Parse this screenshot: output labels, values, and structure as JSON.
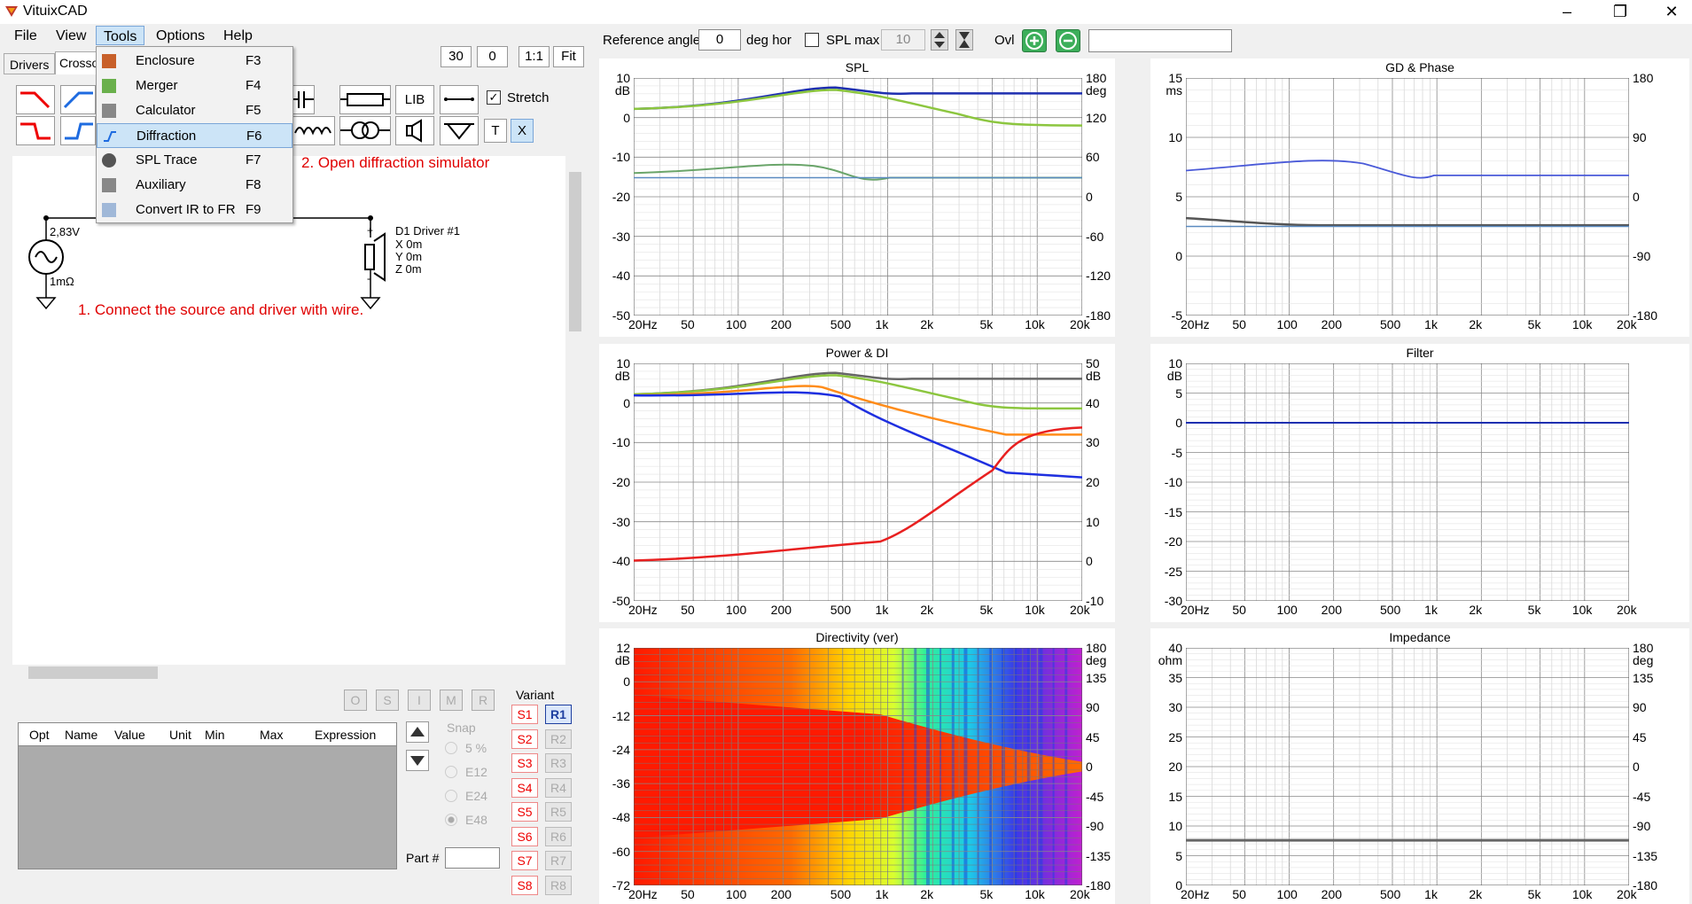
{
  "app": {
    "title": "VituixCAD"
  },
  "menu": {
    "file": "File",
    "view": "View",
    "tools": "Tools",
    "options": "Options",
    "help": "Help"
  },
  "tabs": {
    "drivers": "Drivers",
    "crossover": "Crosso"
  },
  "dropdown": [
    {
      "label": "Enclosure",
      "key": "F3",
      "icon": "enclosure-icon"
    },
    {
      "label": "Merger",
      "key": "F4",
      "icon": "merger-icon"
    },
    {
      "label": "Calculator",
      "key": "F5",
      "icon": "calculator-icon"
    },
    {
      "label": "Diffraction",
      "key": "F6",
      "icon": "diffraction-icon"
    },
    {
      "label": "SPL Trace",
      "key": "F7",
      "icon": "spl-trace-icon"
    },
    {
      "label": "Auxiliary",
      "key": "F8",
      "icon": "auxiliary-icon"
    },
    {
      "label": "Convert IR to FR",
      "key": "F9",
      "icon": "convert-icon"
    }
  ],
  "toolbar": {
    "zoom30": "30",
    "zoom0": "0",
    "oneToOne": "1:1",
    "fit": "Fit",
    "lib": "LIB",
    "stretch": "Stretch",
    "t": "T",
    "x": "X"
  },
  "top": {
    "refAngleLabel": "Reference angle",
    "refAngleValue": "0",
    "degHor": "deg hor",
    "splMax": "SPL max",
    "splMaxValue": "10",
    "ovl": "Ovl"
  },
  "annotations": {
    "a1": "1. Connect the source and driver with wire.",
    "a2": "2. Open diffraction simulator"
  },
  "schematic": {
    "voltage": "2,83V",
    "resistance": "1mΩ",
    "driverName": "D1 Driver #1",
    "x": "X 0m",
    "y": "Y 0m",
    "z": "Z 0m"
  },
  "table": {
    "headers": [
      "Opt",
      "Name",
      "Value",
      "Unit",
      "Min",
      "Max",
      "Expression"
    ]
  },
  "params": {
    "o": "O",
    "s": "S",
    "i": "I",
    "m": "M",
    "r": "R"
  },
  "snap": {
    "title": "Snap",
    "options": [
      "5 %",
      "E12",
      "E24",
      "E48"
    ]
  },
  "variant": {
    "title": "Variant",
    "s": [
      "S1",
      "S2",
      "S3",
      "S4",
      "S5",
      "S6",
      "S7",
      "S8"
    ],
    "r": [
      "R1",
      "R2",
      "R3",
      "R4",
      "R5",
      "R6",
      "R7",
      "R8"
    ]
  },
  "part": {
    "label": "Part #"
  },
  "xticks": [
    "20Hz",
    "50",
    "100",
    "200",
    "500",
    "1k",
    "2k",
    "5k",
    "10k",
    "20k"
  ],
  "plots": {
    "spl": {
      "title": "SPL",
      "left": [
        "10",
        "0",
        "-10",
        "-20",
        "-30",
        "-40",
        "-50"
      ],
      "leftUnit": "dB",
      "right": [
        "180",
        "120",
        "60",
        "0",
        "-60",
        "-120",
        "-180"
      ],
      "rightUnit": "deg"
    },
    "gd": {
      "title": "GD & Phase",
      "left": [
        "15",
        "10",
        "5",
        "0",
        "-5"
      ],
      "leftUnit": "ms",
      "right": [
        "180",
        "90",
        "0",
        "-90",
        "-180"
      ]
    },
    "power": {
      "title": "Power & DI",
      "left": [
        "10",
        "0",
        "-10",
        "-20",
        "-30",
        "-40",
        "-50"
      ],
      "leftUnit": "dB",
      "right": [
        "50",
        "40",
        "30",
        "20",
        "10",
        "0",
        "-10"
      ],
      "rightUnit": "dB"
    },
    "filter": {
      "title": "Filter",
      "left": [
        "10",
        "5",
        "0",
        "-5",
        "-10",
        "-15",
        "-20",
        "-25",
        "-30"
      ],
      "leftUnit": "dB"
    },
    "directivity": {
      "title": "Directivity (ver)",
      "left": [
        "12",
        "0",
        "-12",
        "-24",
        "-36",
        "-48",
        "-60",
        "-72"
      ],
      "leftUnit": "dB",
      "right": [
        "180",
        "135",
        "90",
        "45",
        "0",
        "-45",
        "-90",
        "-135",
        "-180"
      ],
      "rightUnit": "deg"
    },
    "impedance": {
      "title": "Impedance",
      "left": [
        "40",
        "35",
        "30",
        "25",
        "20",
        "15",
        "10",
        "5",
        "0"
      ],
      "leftUnit": "ohm",
      "right": [
        "180",
        "135",
        "90",
        "45",
        "0",
        "-45",
        "-90",
        "-135",
        "-180"
      ],
      "rightUnit": "deg"
    }
  }
}
